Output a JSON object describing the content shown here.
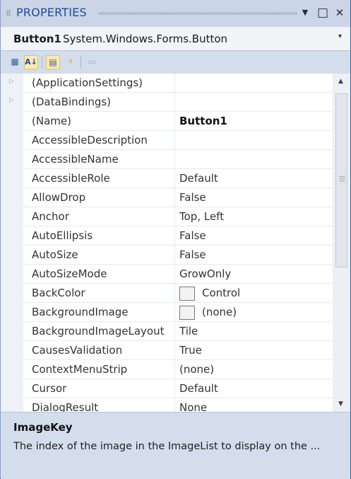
{
  "titlebar": {
    "title": "PROPERTIES",
    "dropdown_icon": "▼",
    "maximize_icon": "□",
    "close_icon": "✕"
  },
  "selector": {
    "object_name": "Button1",
    "object_type": "System.Windows.Forms.Button",
    "caret": "▾"
  },
  "toolbar": {
    "tools": [
      {
        "name": "categorized-button",
        "glyph": "▦",
        "active": false
      },
      {
        "name": "alphabetical-button",
        "glyph": "A↓",
        "active": true
      },
      {
        "name": "properties-button",
        "glyph": "▤",
        "active": true
      },
      {
        "name": "events-button",
        "glyph": "⚡",
        "active": false
      },
      {
        "name": "property-pages-button",
        "glyph": "▭",
        "active": false
      }
    ]
  },
  "grid": {
    "rows": [
      {
        "name": "(ApplicationSettings)",
        "value": "",
        "expandable": true
      },
      {
        "name": "(DataBindings)",
        "value": "",
        "expandable": true
      },
      {
        "name": "(Name)",
        "value": "Button1",
        "bold": true
      },
      {
        "name": "AccessibleDescription",
        "value": ""
      },
      {
        "name": "AccessibleName",
        "value": ""
      },
      {
        "name": "AccessibleRole",
        "value": "Default"
      },
      {
        "name": "AllowDrop",
        "value": "False"
      },
      {
        "name": "Anchor",
        "value": "Top, Left"
      },
      {
        "name": "AutoEllipsis",
        "value": "False"
      },
      {
        "name": "AutoSize",
        "value": "False"
      },
      {
        "name": "AutoSizeMode",
        "value": "GrowOnly"
      },
      {
        "name": "BackColor",
        "value": "Control",
        "swatch": true
      },
      {
        "name": "BackgroundImage",
        "value": "(none)",
        "swatch": true
      },
      {
        "name": "BackgroundImageLayout",
        "value": "Tile"
      },
      {
        "name": "CausesValidation",
        "value": "True"
      },
      {
        "name": "ContextMenuStrip",
        "value": "(none)"
      },
      {
        "name": "Cursor",
        "value": "Default"
      },
      {
        "name": "DialogResult",
        "value": "None"
      }
    ]
  },
  "description": {
    "title": "ImageKey",
    "text": "The index of the image in the ImageList to display on the ..."
  }
}
